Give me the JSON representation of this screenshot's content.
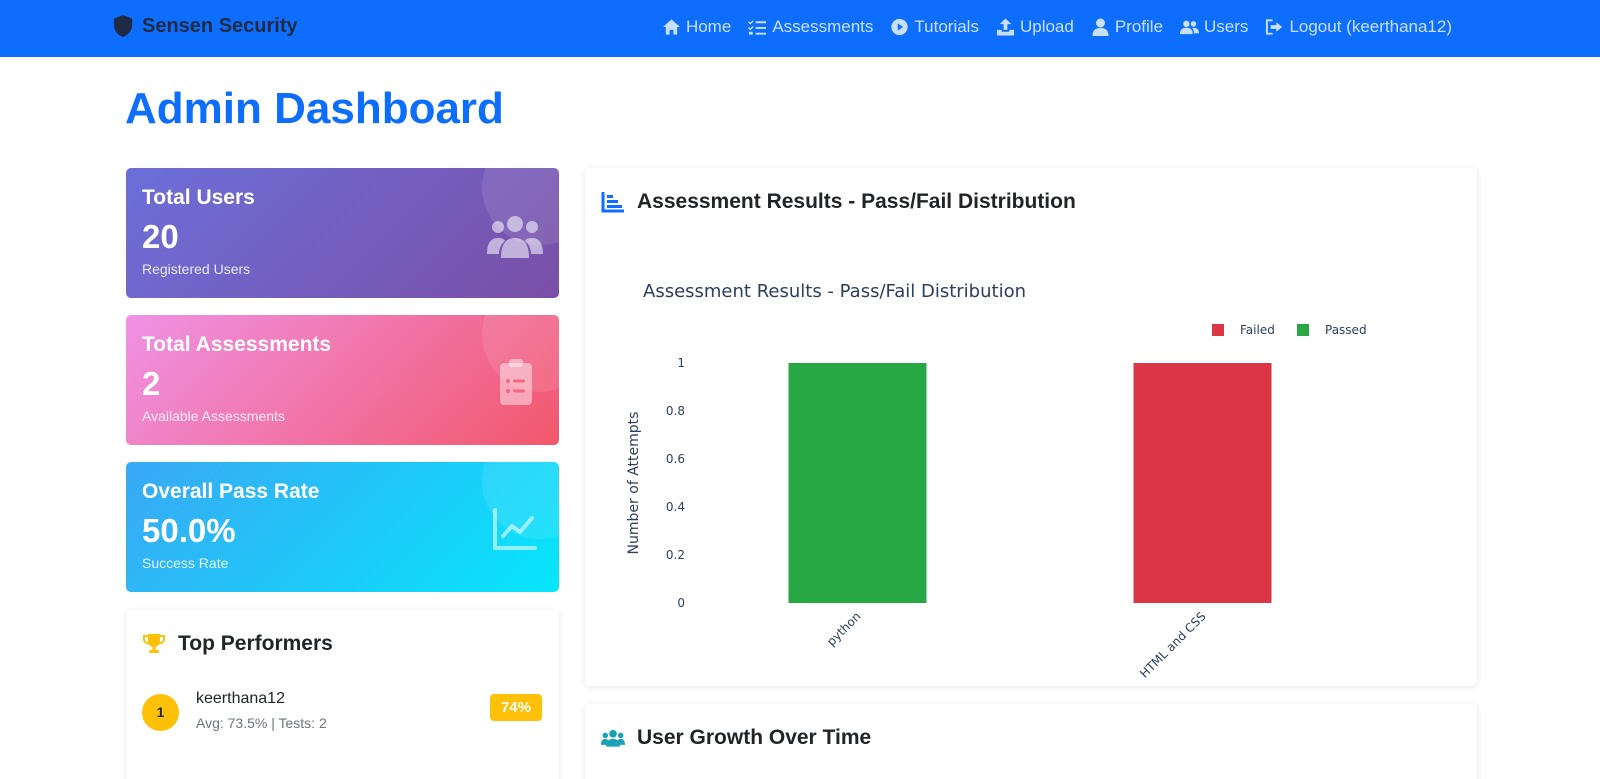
{
  "navbar": {
    "brand": "Sensen Security",
    "links": [
      {
        "label": "Home",
        "icon": "home-icon"
      },
      {
        "label": "Assessments",
        "icon": "list-check-icon"
      },
      {
        "label": "Tutorials",
        "icon": "play-circle-icon"
      },
      {
        "label": "Upload",
        "icon": "upload-icon"
      },
      {
        "label": "Profile",
        "icon": "user-icon"
      },
      {
        "label": "Users",
        "icon": "users-icon"
      },
      {
        "label": "Logout (keerthana12)",
        "icon": "logout-icon"
      }
    ]
  },
  "page": {
    "title": "Admin Dashboard"
  },
  "stats": {
    "users": {
      "title": "Total Users",
      "value": "20",
      "subtitle": "Registered Users",
      "icon": "users-icon"
    },
    "assessments": {
      "title": "Total Assessments",
      "value": "2",
      "subtitle": "Available Assessments",
      "icon": "clipboard-list-icon"
    },
    "pass_rate": {
      "title": "Overall Pass Rate",
      "value": "50.0%",
      "subtitle": "Success Rate",
      "icon": "chart-line-icon"
    }
  },
  "top_performers": {
    "title": "Top Performers",
    "icon": "trophy-icon",
    "items": [
      {
        "rank": "1",
        "name": "keerthana12",
        "meta": "Avg: 73.5% | Tests: 2",
        "badge": "74%"
      }
    ]
  },
  "results_panel": {
    "title": "Assessment Results - Pass/Fail Distribution",
    "icon": "bar-chart-icon"
  },
  "growth_panel": {
    "title": "User Growth Over Time",
    "icon": "users-icon"
  },
  "colors": {
    "primary": "#0d6efd",
    "failed": "#dc3545",
    "passed": "#28a745",
    "warning": "#ffc107"
  },
  "chart_data": {
    "type": "bar",
    "title": "Assessment Results - Pass/Fail Distribution",
    "xlabel": "",
    "ylabel": "Number of Attempts",
    "categories": [
      "python",
      "HTML and CSS"
    ],
    "series": [
      {
        "name": "Failed",
        "values": [
          0,
          1
        ],
        "color": "#dc3545"
      },
      {
        "name": "Passed",
        "values": [
          1,
          0
        ],
        "color": "#28a745"
      }
    ],
    "ylim": [
      0,
      1
    ],
    "yticks": [
      "0",
      "0.2",
      "0.4",
      "0.6",
      "0.8",
      "1"
    ],
    "stacked": true,
    "legend": "top-right",
    "grid": false
  }
}
